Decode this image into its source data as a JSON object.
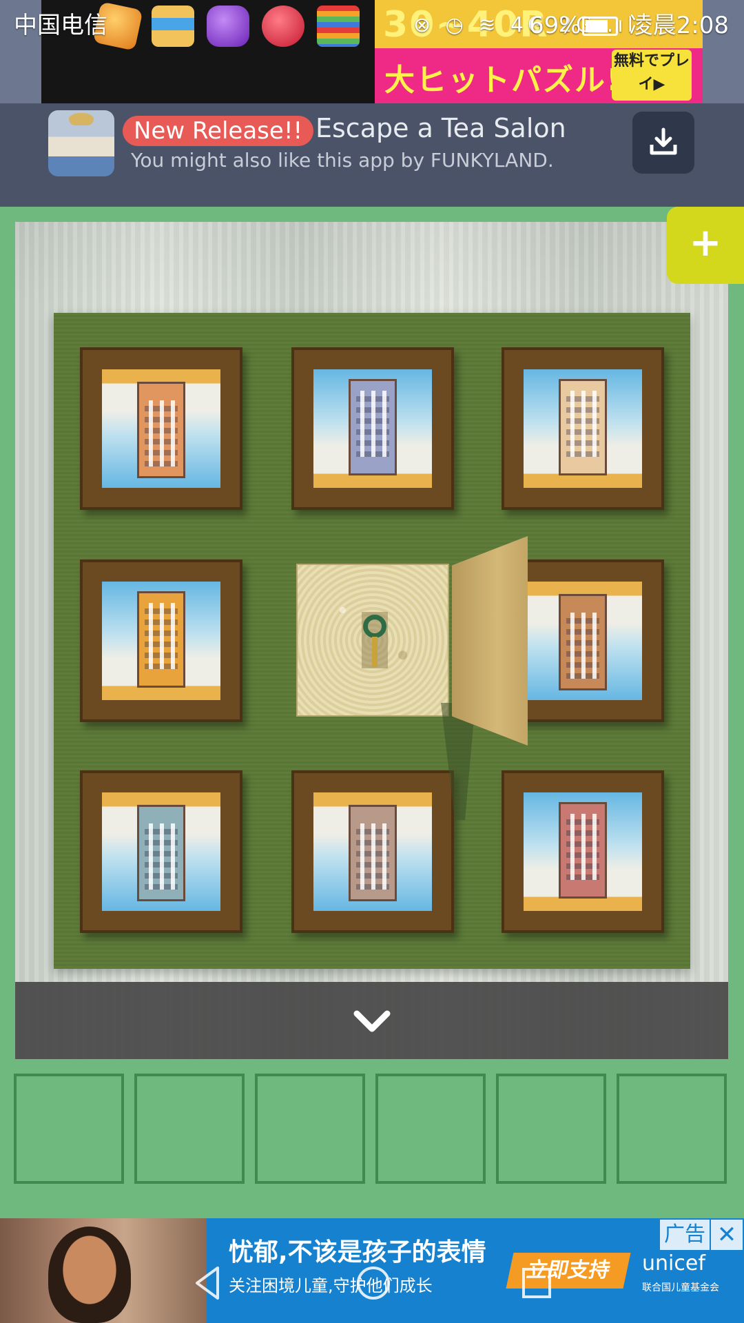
{
  "status_bar": {
    "carrier": "中国电信",
    "icons": "⊗ ◷ ≋ 4G 2G .ıl",
    "battery": "69%",
    "time": "凌晨2:08"
  },
  "top_ad": {
    "pink_number": "30~40R",
    "pink_text": "大ヒットパズル!!",
    "cta": "無料でプレイ▶"
  },
  "promo": {
    "badge": "New Release!!",
    "title": "Escape a Tea Salon",
    "subtitle": "You might also like this app by FUNKYLAND.",
    "download_icon": "download-icon"
  },
  "scene": {
    "plus_label": "+",
    "collapse_icon": "chevron-down-icon",
    "pictures": [
      {
        "id": "tl",
        "orientation": "down",
        "colors": "#e1955f"
      },
      {
        "id": "tm",
        "orientation": "up",
        "colors": "#9aa2c8"
      },
      {
        "id": "tr",
        "orientation": "up",
        "colors": "#e8c9a0"
      },
      {
        "id": "ml",
        "orientation": "up",
        "colors": "#e9a33c"
      },
      {
        "id": "mr",
        "orientation": "down",
        "colors": "#c88958"
      },
      {
        "id": "bl",
        "orientation": "down",
        "colors": "#8fb0b8"
      },
      {
        "id": "bm",
        "orientation": "down",
        "colors": "#b89a8a"
      },
      {
        "id": "br",
        "orientation": "up",
        "colors": "#c87a72"
      }
    ]
  },
  "inventory": {
    "slots": 6
  },
  "bottom_ad": {
    "headline": "忧郁,不该是孩子的表情",
    "sub": "关注困境儿童,守护他们成长",
    "cta": "立即支持",
    "org": "unicef",
    "org_sub": "联合国儿童基金会",
    "ad_label": "广告",
    "close": "✕"
  },
  "colors": {
    "background": "#6fb87e",
    "promo_bg": "#4b5368",
    "plus_button": "#d3d81c",
    "slot_border": "#3f8a4e"
  }
}
